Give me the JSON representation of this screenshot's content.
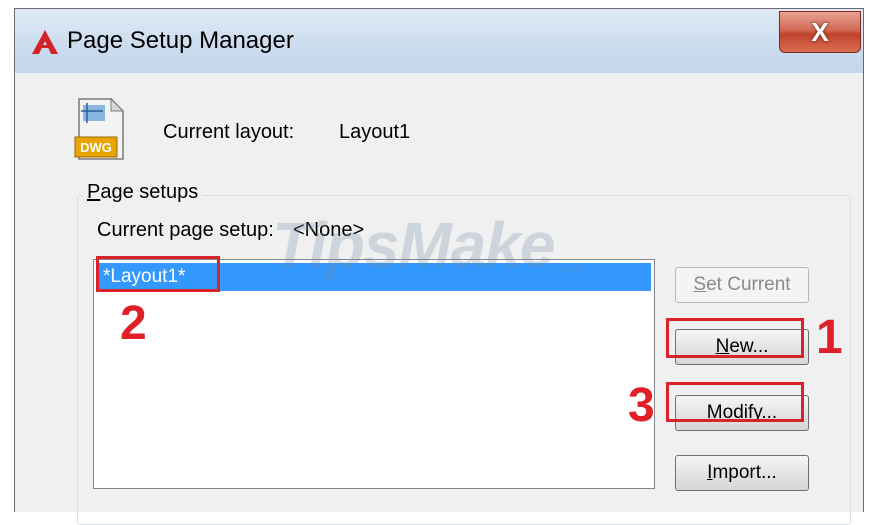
{
  "window": {
    "title": "Page Setup Manager",
    "close_glyph": "X"
  },
  "current_layout": {
    "label": "Current layout:",
    "value": "Layout1",
    "icon_text": "DWG"
  },
  "page_setups": {
    "group_title": "Page setups",
    "current_setup_label": "Current page setup:",
    "current_setup_value": "<None>",
    "items": [
      "*Layout1*"
    ]
  },
  "buttons": {
    "set_current": {
      "pre": "",
      "accel": "S",
      "post": "et Current"
    },
    "new": {
      "pre": "",
      "accel": "N",
      "post": "ew..."
    },
    "modify": {
      "pre": "",
      "accel": "M",
      "post": "odify..."
    },
    "import": {
      "pre": "",
      "accel": "I",
      "post": "mport..."
    }
  },
  "annotations": {
    "step1": "1",
    "step2": "2",
    "step3": "3",
    "color": "#e01f26"
  },
  "watermark": {
    "text": "TipsMake",
    "suffix": ".com"
  },
  "icons": [
    "autocad-logo-icon",
    "close-icon",
    "dwg-file-icon"
  ]
}
